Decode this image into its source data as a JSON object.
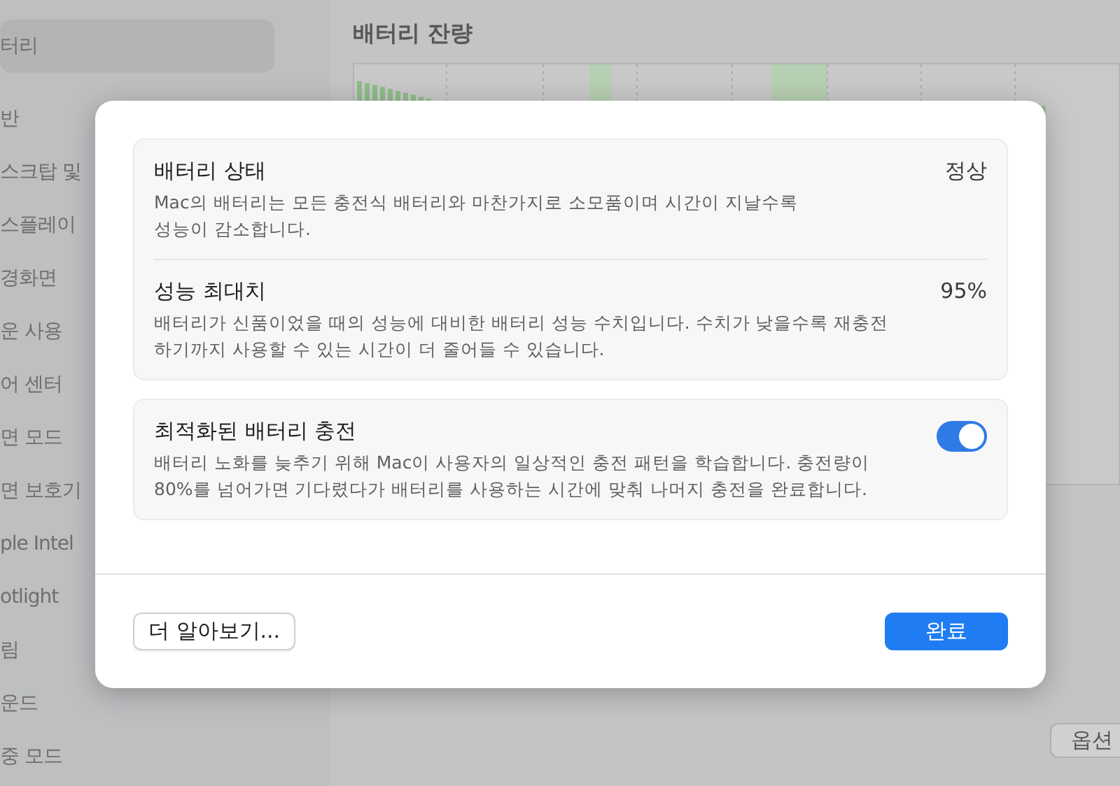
{
  "sidebar": {
    "items": [
      {
        "label": "터리",
        "selected": true
      },
      {
        "label": "반",
        "selected": false
      },
      {
        "label": "스크탑 및",
        "selected": false
      },
      {
        "label": "스플레이",
        "selected": false
      },
      {
        "label": "경화면",
        "selected": false
      },
      {
        "label": "운 사용",
        "selected": false
      },
      {
        "label": "어 센터",
        "selected": false
      },
      {
        "label": "면 모드",
        "selected": false
      },
      {
        "label": "면 보호기",
        "selected": false
      },
      {
        "label": "ple Intel",
        "selected": false
      },
      {
        "label": "otlight",
        "selected": false
      },
      {
        "label": "림",
        "selected": false
      },
      {
        "label": "운드",
        "selected": false
      },
      {
        "label": "중 모드",
        "selected": false
      }
    ]
  },
  "main": {
    "section_title": "배터리 잔량",
    "options_button": "옵션"
  },
  "dialog": {
    "cards": [
      {
        "rows": [
          {
            "kind": "value",
            "title": "배터리 상태",
            "description": "Mac의 배터리는 모든 충전식 배터리와 마찬가지로 소모품이며 시간이 지날수록\n성능이 감소합니다.",
            "value": "정상"
          },
          {
            "kind": "value",
            "title": "성능 최대치",
            "description": "배터리가 신품이었을 때의 성능에 대비한 배터리 성능 수치입니다. 수치가 낮을수록 재충전\n하기까지 사용할 수 있는 시간이 더 줄어들 수 있습니다.",
            "value": "95%"
          }
        ]
      },
      {
        "rows": [
          {
            "kind": "toggle",
            "title": "최적화된 배터리 충전",
            "description": "배터리 노화를 늦추기 위해 Mac이 사용자의 일상적인 충전 패턴을 학습합니다. 충전량이\n80%를 넘어가면 기다렸다가 배터리를 사용하는 시간에 맞춰 나머지 충전을 완료합니다.",
            "on": true
          }
        ]
      }
    ],
    "secondary_button": "더 알아보기...",
    "primary_button": "완료"
  }
}
